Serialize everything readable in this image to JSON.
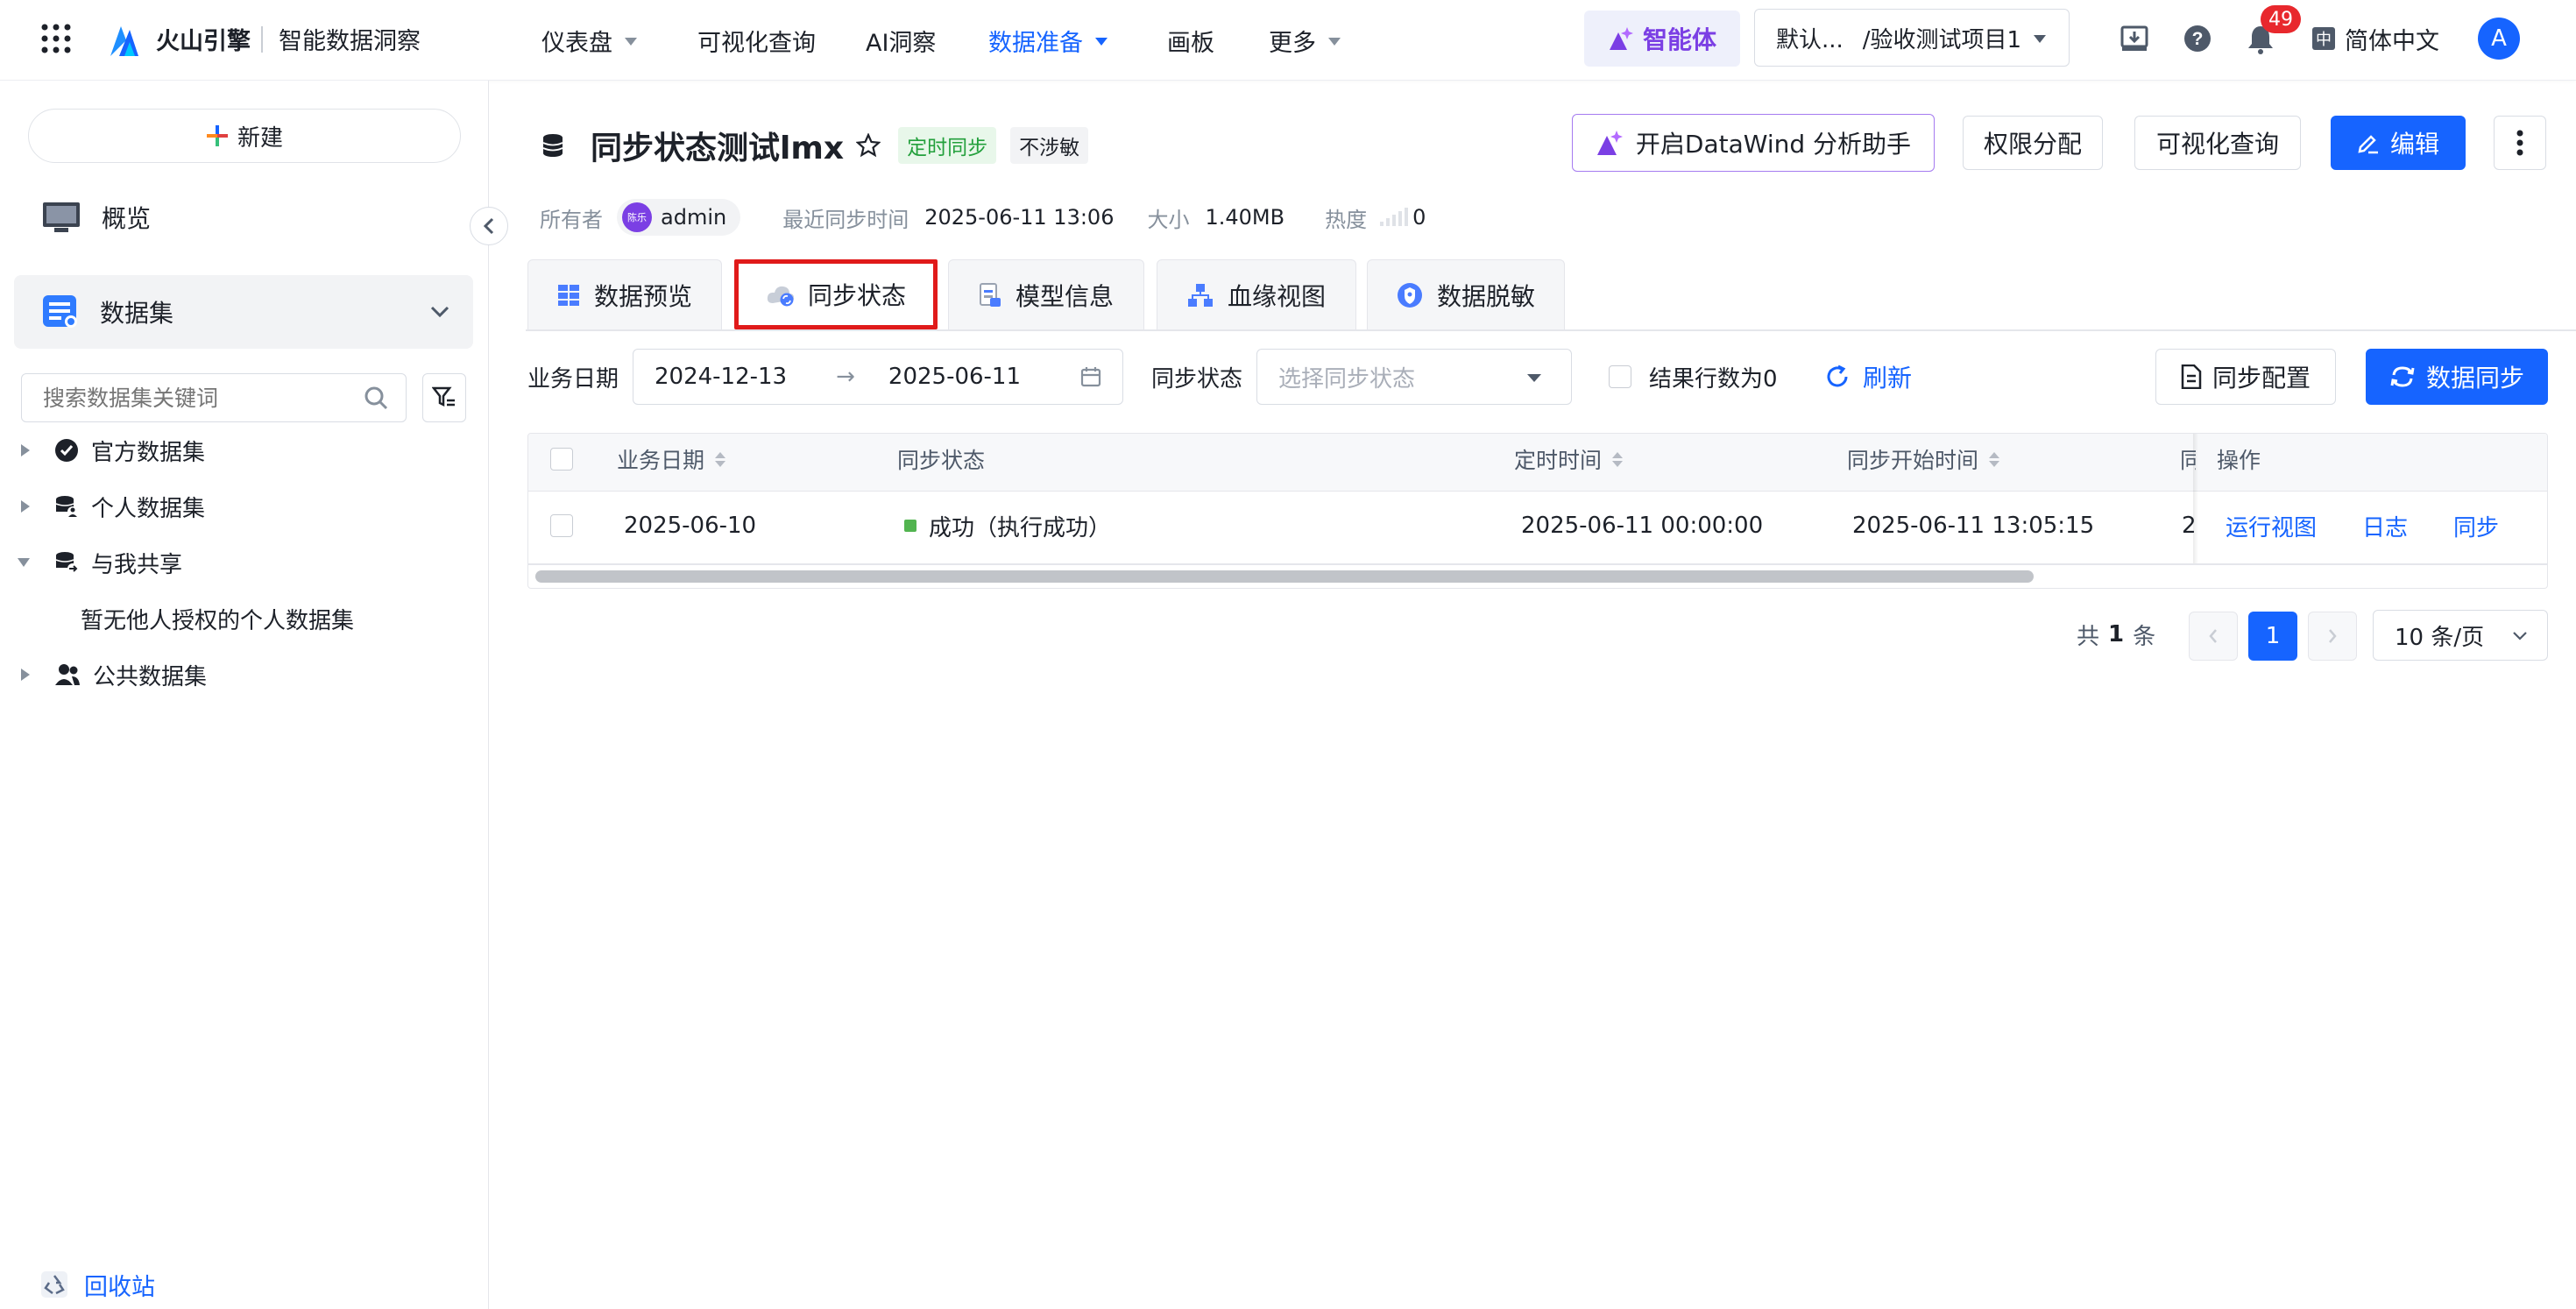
{
  "topbar": {
    "brand": "火山引擎",
    "product": "智能数据洞察",
    "nav": [
      {
        "label": "仪表盘",
        "has_caret": true
      },
      {
        "label": "可视化查询",
        "has_caret": false
      },
      {
        "label": "AI洞察",
        "has_caret": false
      },
      {
        "label": "数据准备",
        "has_caret": true,
        "active": true
      },
      {
        "label": "画板",
        "has_caret": false
      },
      {
        "label": "更多",
        "has_caret": true
      }
    ],
    "agent_label": "智能体",
    "project_selector": {
      "space": "默认...",
      "project": "/验收测试项目1"
    },
    "notification_count": "49",
    "language": "简体中文",
    "avatar_initial": "A"
  },
  "sidebar": {
    "new_button": "新建",
    "overview": "概览",
    "dataset_label": "数据集",
    "search_placeholder": "搜索数据集关键词",
    "tree": [
      {
        "label": "官方数据集",
        "icon": "verified-icon",
        "expanded": false
      },
      {
        "label": "个人数据集",
        "icon": "personal-db-icon",
        "expanded": false
      },
      {
        "label": "与我共享",
        "icon": "shared-db-icon",
        "expanded": true,
        "empty_text": "暂无他人授权的个人数据集"
      },
      {
        "label": "公共数据集",
        "icon": "group-icon",
        "expanded": false
      }
    ],
    "recycle_bin": "回收站"
  },
  "header": {
    "title": "同步状态测试lmx",
    "tag_sync": "定时同步",
    "tag_sensitive": "不涉敏",
    "assistant_button": "开启DataWind 分析助手",
    "permission_button": "权限分配",
    "visual_query_button": "可视化查询",
    "edit_button": "编辑",
    "meta": {
      "owner_label": "所有者",
      "owner_avatar_text": "陈乐",
      "owner": "admin",
      "last_sync_label": "最近同步时间",
      "last_sync": "2025-06-11 13:06",
      "size_label": "大小",
      "size": "1.40MB",
      "heat_label": "热度",
      "heat": "0"
    }
  },
  "tabs": [
    {
      "label": "数据预览",
      "icon": "grid-icon"
    },
    {
      "label": "同步状态",
      "icon": "cloud-sync-icon",
      "active": true
    },
    {
      "label": "模型信息",
      "icon": "model-icon"
    },
    {
      "label": "血缘视图",
      "icon": "lineage-icon"
    },
    {
      "label": "数据脱敏",
      "icon": "mask-icon"
    }
  ],
  "filters": {
    "date_label": "业务日期",
    "date_start": "2024-12-13",
    "date_arrow": "→",
    "date_end": "2025-06-11",
    "status_label": "同步状态",
    "status_placeholder": "选择同步状态",
    "zero_rows_label": "结果行数为0",
    "refresh_label": "刷新",
    "sync_config_button": "同步配置",
    "data_sync_button": "数据同步"
  },
  "table": {
    "headers": {
      "business_date": "业务日期",
      "sync_status": "同步状态",
      "scheduled_time": "定时时间",
      "sync_start": "同步开始时间",
      "truncated_col": "同",
      "actions": "操作"
    },
    "rows": [
      {
        "business_date": "2025-06-10",
        "status": "成功（执行成功）",
        "status_color": "#52b450",
        "scheduled_time": "2025-06-11 00:00:00",
        "sync_start": "2025-06-11 13:05:15",
        "truncated_value": "2",
        "actions": [
          "运行视图",
          "日志",
          "同步"
        ]
      }
    ]
  },
  "pagination": {
    "total_prefix": "共",
    "total": "1",
    "total_suffix": "条",
    "current_page": "1",
    "page_size": "10 条/页"
  },
  "colors": {
    "accent": "#1664ff",
    "tag_green_bg": "#e8f7ea",
    "tag_green_text": "#23a03c",
    "highlight_box": "#e01a1a",
    "agent_purple": "#7b3fe4"
  }
}
